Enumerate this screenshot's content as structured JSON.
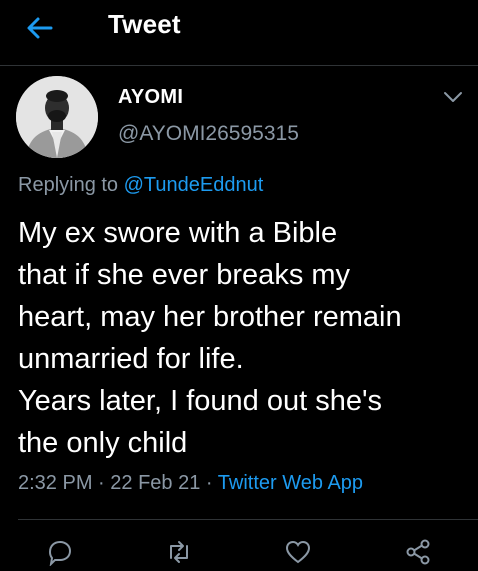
{
  "header": {
    "title": "Tweet",
    "back_icon": "arrow-left-icon",
    "accent_color": "#1d9bf0"
  },
  "tweet": {
    "author": {
      "name": "AYOMI",
      "handle": "@AYOMI26595315",
      "avatar_icon": "avatar-photo"
    },
    "reply": {
      "prefix": "Replying to",
      "mention": "@TundeEddnut"
    },
    "text_lines": [
      "My ex swore with a Bible",
      "that if she ever breaks my",
      "heart, may her brother remain",
      "unmarried for life.",
      "Years later, I found out she's",
      "the only child"
    ],
    "meta": {
      "time": "2:32 PM",
      "separator": "·",
      "date": "22 Feb 21",
      "source": "Twitter Web App"
    }
  },
  "actions": [
    {
      "icon": "reply-icon"
    },
    {
      "icon": "retweet-icon"
    },
    {
      "icon": "like-icon"
    },
    {
      "icon": "share-icon"
    }
  ]
}
